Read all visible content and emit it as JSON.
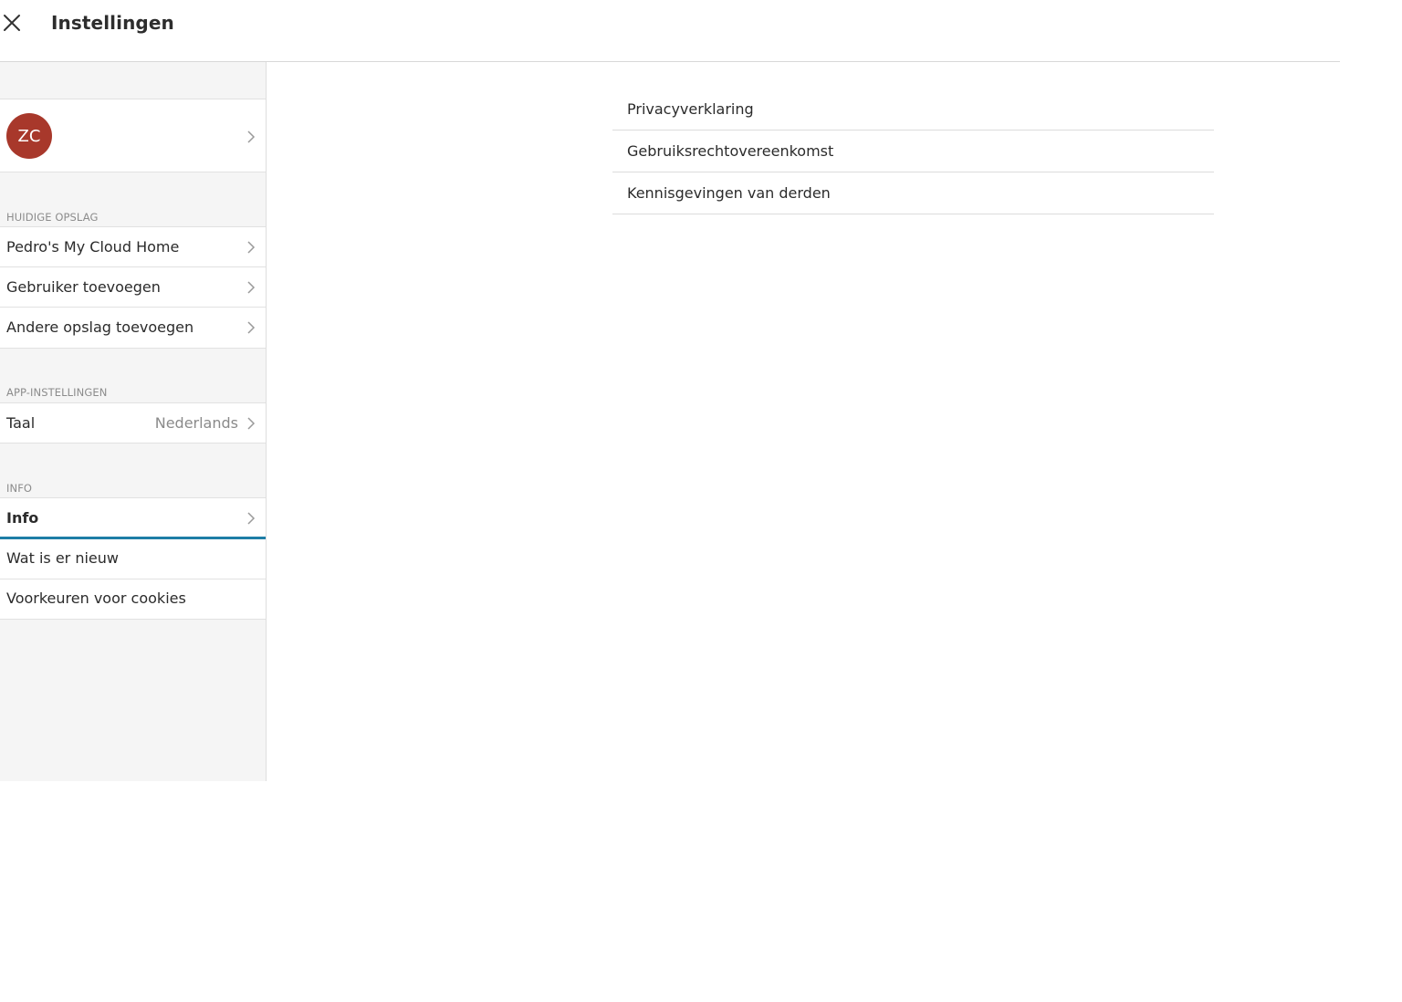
{
  "header": {
    "title": "Instellingen",
    "close_icon": "close-icon"
  },
  "sidebar": {
    "account": {
      "initials": "ZC",
      "avatar_color": "#a8382b"
    },
    "sections": {
      "storage": {
        "header": "HUIDIGE OPSLAG",
        "items": [
          {
            "label": "Pedro's My Cloud Home"
          },
          {
            "label": "Gebruiker toevoegen"
          },
          {
            "label": "Andere opslag toevoegen"
          }
        ]
      },
      "app": {
        "header": "APP-INSTELLINGEN",
        "items": [
          {
            "label": "Taal",
            "value": "Nederlands"
          }
        ]
      },
      "info": {
        "header": "INFO",
        "items": [
          {
            "label": "Info",
            "selected": true
          },
          {
            "label": "Wat is er nieuw"
          },
          {
            "label": "Voorkeuren voor cookies"
          }
        ]
      }
    }
  },
  "main": {
    "items": [
      {
        "label": "Privacyverklaring"
      },
      {
        "label": "Gebruiksrechtovereenkomst"
      },
      {
        "label": "Kennisgevingen van derden"
      }
    ]
  },
  "colors": {
    "accent": "#1e7ea6",
    "avatar": "#a8382b",
    "sidebar_bg": "#f5f5f5"
  }
}
